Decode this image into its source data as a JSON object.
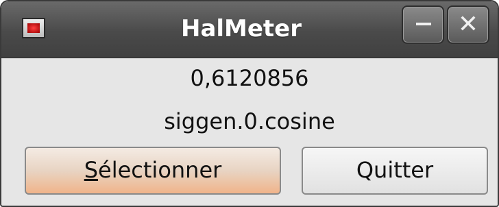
{
  "window": {
    "title": "HalMeter",
    "controls": {
      "minimize_icon": "minimize-icon",
      "close_icon": "close-icon"
    }
  },
  "meter": {
    "value": "0,6120856",
    "signal": "siggen.0.cosine"
  },
  "buttons": {
    "select": {
      "mnemonic": "S",
      "rest": "électionner"
    },
    "quit": "Quitter"
  },
  "colors": {
    "titlebar": "#4a4a4a",
    "window_bg": "#e6e6e6",
    "focused_button_accent": "#f0b48a"
  }
}
